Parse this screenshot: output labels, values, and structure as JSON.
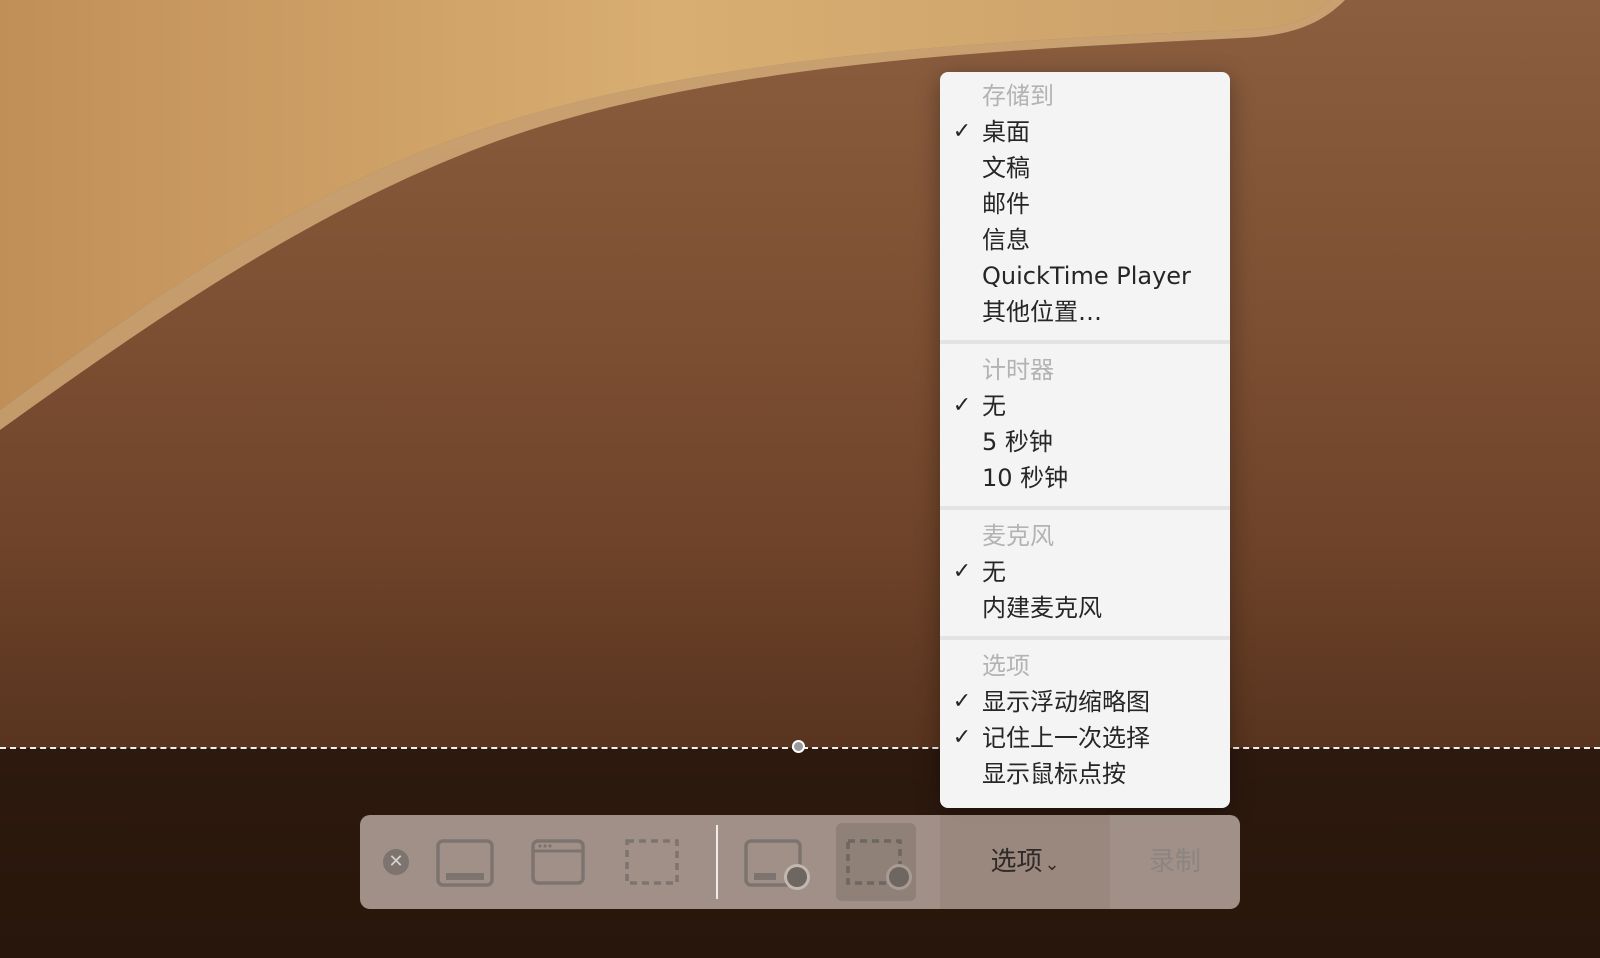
{
  "menu": {
    "sections": [
      {
        "header": "存储到",
        "items": [
          {
            "label": "桌面",
            "checked": true
          },
          {
            "label": "文稿",
            "checked": false
          },
          {
            "label": "邮件",
            "checked": false
          },
          {
            "label": "信息",
            "checked": false
          },
          {
            "label": "QuickTime Player",
            "checked": false
          },
          {
            "label": "其他位置…",
            "checked": false
          }
        ]
      },
      {
        "header": "计时器",
        "items": [
          {
            "label": "无",
            "checked": true
          },
          {
            "label": "5 秒钟",
            "checked": false
          },
          {
            "label": "10 秒钟",
            "checked": false
          }
        ]
      },
      {
        "header": "麦克风",
        "items": [
          {
            "label": "无",
            "checked": true
          },
          {
            "label": "内建麦克风",
            "checked": false
          }
        ]
      },
      {
        "header": "选项",
        "items": [
          {
            "label": "显示浮动缩略图",
            "checked": true
          },
          {
            "label": "记住上一次选择",
            "checked": true
          },
          {
            "label": "显示鼠标点按",
            "checked": false
          }
        ]
      }
    ]
  },
  "toolbar": {
    "close_glyph": "✕",
    "options_label": "选项",
    "options_chevron": "⌄",
    "record_label": "录制"
  },
  "check_glyph": "✓",
  "colors": {
    "menu_bg": "#f4f4f4",
    "menu_header": "#b3b3b3",
    "toolbar_bg": "#beafa8",
    "icon_gray": "#7d746f"
  }
}
